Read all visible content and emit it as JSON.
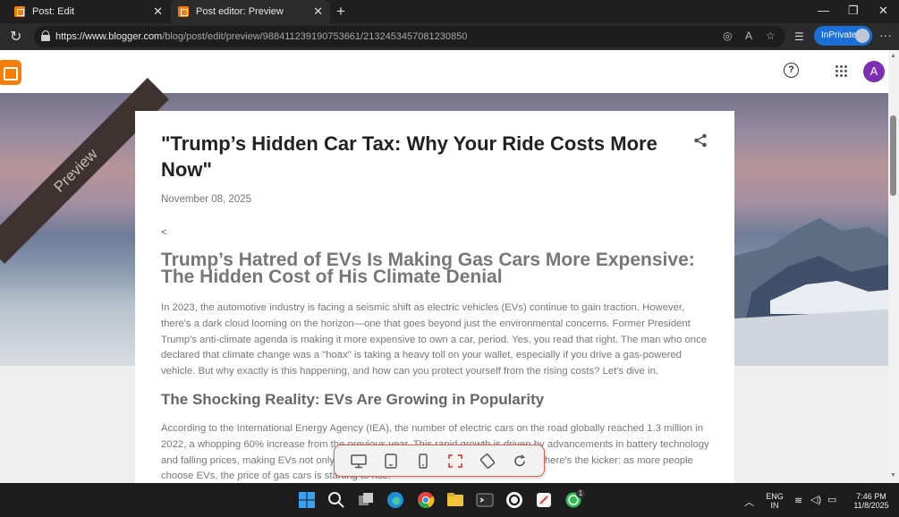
{
  "browser": {
    "tabs": [
      {
        "title": "Post: Edit"
      },
      {
        "title": "Post editor: Preview"
      }
    ],
    "url_domain": "https://www.blogger.com",
    "url_path": "/blog/post/edit/preview/988411239190753661/2132453457081230850",
    "inprivate_label": "InPrivate"
  },
  "blogger": {
    "avatar_letter": "A",
    "ribbon_label": "Preview"
  },
  "post": {
    "title": "\"Trump’s Hidden Car Tax: Why Your Ride Costs More Now\"",
    "date": "November 08, 2025",
    "stray_text": "<",
    "heading1": "Trump’s Hatred of EVs Is Making Gas Cars More Expensive: The Hidden Cost of His Climate Denial",
    "para1": "In 2023, the automotive industry is facing a seismic shift as electric vehicles (EVs) continue to gain traction. However, there's a dark cloud looming on the horizon—one that goes beyond just the environmental concerns. Former President Trump's anti-climate agenda is making it more expensive to own a car, period. Yes, you read that right. The man who once declared that climate change was a \"hoax\" is taking a heavy toll on your wallet, especially if you drive a gas-powered vehicle. But why exactly is this happening, and how can you protect yourself from the rising costs? Let's dive in.",
    "heading2": "The Shocking Reality: EVs Are Growing in Popularity",
    "para2": "According to the International Energy Agency (IEA), the number of electric cars on the road globally reached 1.3 million in 2022, a whopping 60% increase from the previous year. This rapid growth is driven by advancements in battery technology and falling prices, making EVs not only more accessible but also more appealing. But here's the kicker: as more people choose EVs, the price of gas cars is starting to rise."
  },
  "taskbar": {
    "lang_line1": "ENG",
    "lang_line2": "IN",
    "time": "7:46 PM",
    "date": "11/8/2025",
    "whatsapp_badge": "1"
  },
  "colors": {
    "blogger_orange": "#f57d00",
    "avatar_purple": "#7b2fb3",
    "inprivate_blue": "#1d6fd8",
    "devtool_border": "#e06050"
  }
}
